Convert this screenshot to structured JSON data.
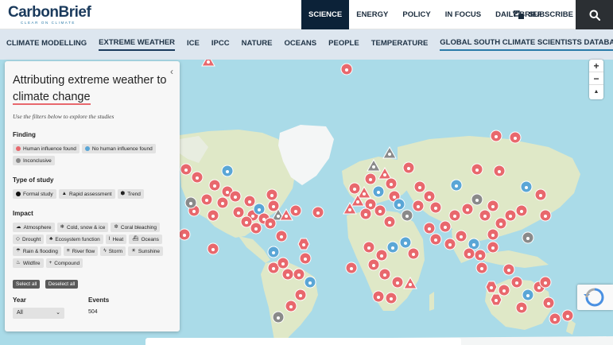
{
  "logo": {
    "name": "CarbonBrief",
    "tagline": "CLEAR ON CLIMATE"
  },
  "header": {
    "nav": [
      "SCIENCE",
      "ENERGY",
      "POLICY",
      "IN FOCUS",
      "DAILY BRIEF"
    ],
    "active": "SCIENCE",
    "subscribe_label": "SUBSCRIBE"
  },
  "subnav": {
    "items": [
      "CLIMATE MODELLING",
      "EXTREME WEATHER",
      "ICE",
      "IPCC",
      "NATURE",
      "OCEANS",
      "PEOPLE",
      "TEMPERATURE",
      "GLOBAL SOUTH CLIMATE SCIENTISTS DATABASE"
    ],
    "active": "EXTREME WEATHER"
  },
  "panel": {
    "title_line1": "Attributing extreme weather to",
    "title_line2": "climate change",
    "hint": "Use the filters below to explore the studies",
    "finding_label": "Finding",
    "findings": [
      {
        "label": "Human influence found",
        "color": "#e8686d"
      },
      {
        "label": "No human influence found",
        "color": "#5aa6d6"
      },
      {
        "label": "Inconclusive",
        "color": "#8a8a8a"
      }
    ],
    "study_label": "Type of study",
    "studies": [
      {
        "label": "Formal study",
        "icon": "circle-icon"
      },
      {
        "label": "Rapid assessment",
        "icon": "triangle-icon"
      },
      {
        "label": "Trend",
        "icon": "hexagon-icon"
      }
    ],
    "impact_label": "Impact",
    "impacts": [
      {
        "label": "Atmosphere",
        "icon": "cloud-icon",
        "glyph": "☁"
      },
      {
        "label": "Cold, snow & ice",
        "icon": "snowflake-icon",
        "glyph": "❄"
      },
      {
        "label": "Coral bleaching",
        "icon": "coral-icon",
        "glyph": "✲"
      },
      {
        "label": "Drought",
        "icon": "drop-outline-icon",
        "glyph": "◇"
      },
      {
        "label": "Ecosystem function",
        "icon": "tree-icon",
        "glyph": "♣"
      },
      {
        "label": "Heat",
        "icon": "thermometer-icon",
        "glyph": "ǀ"
      },
      {
        "label": "Oceans",
        "icon": "boat-icon",
        "glyph": "⛴"
      },
      {
        "label": "Rain & flooding",
        "icon": "rain-icon",
        "glyph": "☂"
      },
      {
        "label": "River flow",
        "icon": "waves-icon",
        "glyph": "≡"
      },
      {
        "label": "Storm",
        "icon": "lightning-icon",
        "glyph": "ϟ"
      },
      {
        "label": "Sunshine",
        "icon": "sun-icon",
        "glyph": "☀"
      },
      {
        "label": "Wildfire",
        "icon": "fire-icon",
        "glyph": "♨"
      },
      {
        "label": "Compound",
        "icon": "plus-icon",
        "glyph": "+"
      }
    ],
    "select_all": "Select all",
    "deselect_all": "Deselect all",
    "year_label": "Year",
    "year_value": "All",
    "events_label": "Events",
    "events_count": "504"
  },
  "map": {
    "zoom_in": "+",
    "zoom_out": "−",
    "reset": "▲",
    "colors": {
      "human": "#e8686d",
      "none": "#5aa6d6",
      "inconclusive": "#8a8a8a",
      "ocean": "#aadbe8",
      "land": "#dfe8c7",
      "ice": "#f4f6f6"
    }
  }
}
